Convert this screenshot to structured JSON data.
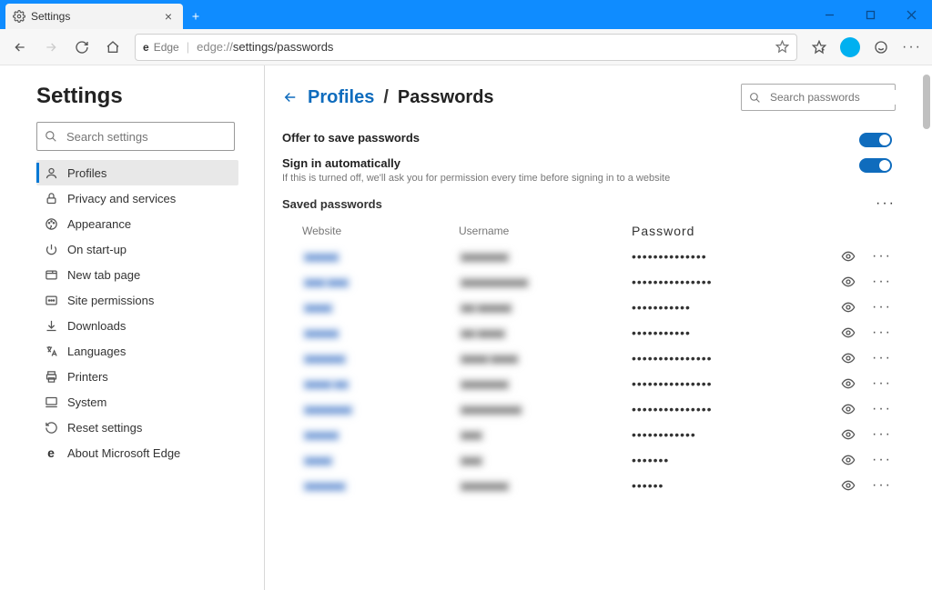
{
  "window": {
    "tab_title": "Settings",
    "tab_icon": "gear-icon"
  },
  "toolbar": {
    "edge_label": "Edge",
    "url_prefix": "edge://",
    "url_mid": "settings/",
    "url_tail": "passwords"
  },
  "sidebar": {
    "title": "Settings",
    "search_placeholder": "Search settings",
    "items": [
      {
        "icon": "person-icon",
        "label": "Profiles",
        "active": true
      },
      {
        "icon": "lock-icon",
        "label": "Privacy and services"
      },
      {
        "icon": "paint-icon",
        "label": "Appearance"
      },
      {
        "icon": "power-icon",
        "label": "On start-up"
      },
      {
        "icon": "tab-icon",
        "label": "New tab page"
      },
      {
        "icon": "perm-icon",
        "label": "Site permissions"
      },
      {
        "icon": "download-icon",
        "label": "Downloads"
      },
      {
        "icon": "lang-icon",
        "label": "Languages"
      },
      {
        "icon": "printer-icon",
        "label": "Printers"
      },
      {
        "icon": "system-icon",
        "label": "System"
      },
      {
        "icon": "reset-icon",
        "label": "Reset settings"
      },
      {
        "icon": "edge-icon",
        "label": "About Microsoft Edge"
      }
    ]
  },
  "main": {
    "breadcrumb_root": "Profiles",
    "breadcrumb_sep": "/",
    "breadcrumb_current": "Passwords",
    "search_placeholder": "Search passwords",
    "settings": [
      {
        "title": "Offer to save passwords",
        "desc": "",
        "on": true
      },
      {
        "title": "Sign in automatically",
        "desc": "If this is turned off, we'll ask you for permission every time before signing in to a website",
        "on": true
      }
    ],
    "saved_heading": "Saved passwords",
    "columns": {
      "site": "Website",
      "user": "Username",
      "pass": "Password"
    },
    "rows": [
      {
        "site": "■■■■■",
        "user": "■■■■■■■",
        "pass": "••••••••••••••"
      },
      {
        "site": "■■■ ■■■",
        "user": "■■■■■■■■■■",
        "pass": "•••••••••••••••"
      },
      {
        "site": "■■■■",
        "user": "■■ ■■■■■",
        "pass": "•••••••••••"
      },
      {
        "site": "■■■■■",
        "user": "■■ ■■■■",
        "pass": "•••••••••••"
      },
      {
        "site": "■■■■■■",
        "user": "■■■■ ■■■■",
        "pass": "•••••••••••••••"
      },
      {
        "site": "■■■■ ■■",
        "user": "■■■■■■■",
        "pass": "•••••••••••••••"
      },
      {
        "site": "■■■■■■■",
        "user": "■■■■■■■■■",
        "pass": "•••••••••••••••"
      },
      {
        "site": "■■■■■",
        "user": "■■■",
        "pass": "••••••••••••"
      },
      {
        "site": "■■■■",
        "user": "■■■",
        "pass": "•••••••"
      },
      {
        "site": "■■■■■■",
        "user": "■■■■■■■",
        "pass": "••••••"
      }
    ]
  },
  "colors": {
    "accent": "#0F6CBD",
    "titlebar": "#0F8CFF"
  }
}
